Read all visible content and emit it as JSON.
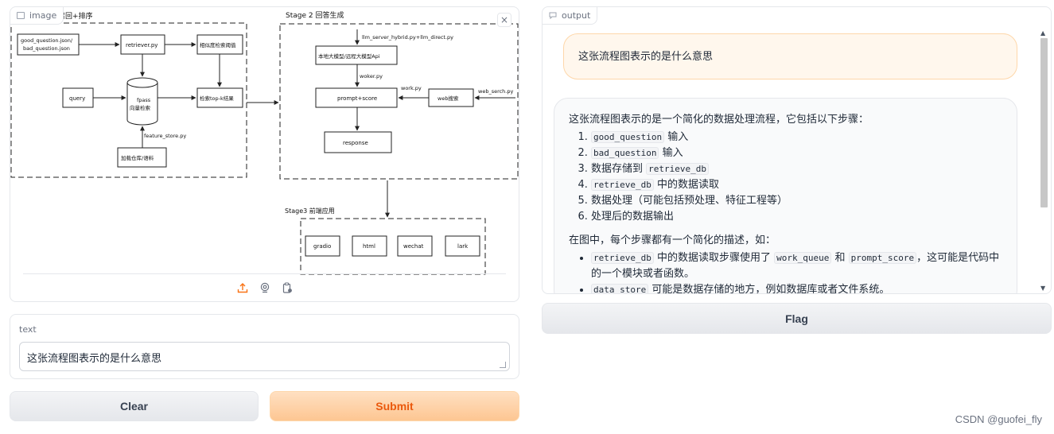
{
  "image_block": {
    "label": "image",
    "label_icon": "image-icon",
    "close_icon": "close-icon",
    "close_symbol": "×",
    "toolbar_icons": [
      "upload-icon",
      "webcam-icon",
      "clipboard-icon"
    ]
  },
  "diagram": {
    "stage1_title": "召回+排序",
    "stage2_title": "Stage 2 回答生成",
    "stage3_title": "Stage3 前端应用",
    "stage1_nodes": {
      "source": [
        "good_question.json/",
        "bad_question.json"
      ],
      "retriever": "retriever.py",
      "threshold": "相似度检索阈值",
      "query": "query",
      "db": [
        "fpass",
        "向量检索"
      ],
      "topk": "检索top-k结果",
      "feature_edge": "feature_store.py",
      "knowledge": "加载仓库/语料"
    },
    "stage2_nodes": {
      "top_edge": "llm_server_hybrid.py+llm_direct.py",
      "model": "本地大模型/远程大模型Api",
      "worker_edge": "woker.py",
      "prompt": "prompt+score",
      "work_edge": "work.py",
      "web": "web搜索",
      "web_edge": "web_serch.py",
      "response": "response"
    },
    "stage3_nodes": [
      "gradio",
      "html",
      "wechat",
      "lark"
    ]
  },
  "text_block": {
    "label": "text",
    "value": "这张流程图表示的是什么意思"
  },
  "buttons": {
    "clear": "Clear",
    "submit": "Submit",
    "flag": "Flag"
  },
  "output_block": {
    "label": "output",
    "label_icon": "chat-icon",
    "user_message": "这张流程图表示的是什么意思",
    "bot_intro": "这张流程图表示的是一个简化的数据处理流程，它包括以下步骤：",
    "steps": [
      {
        "code": "good_question",
        "text": " 输入"
      },
      {
        "code": "bad_question",
        "text": " 输入"
      },
      {
        "pre": "数据存储到 ",
        "code": "retrieve_db",
        "text": ""
      },
      {
        "code": "retrieve_db",
        "text": " 中的数据读取"
      },
      {
        "pre": "数据处理（可能包括预处理、特征工程等）",
        "code": "",
        "text": ""
      },
      {
        "pre": "处理后的数据输出",
        "code": "",
        "text": ""
      }
    ],
    "para2": "在图中，每个步骤都有一个简化的描述，如：",
    "bullet1": {
      "code1": "retrieve_db",
      "t1": " 中的数据读取步骤使用了 ",
      "code2": "work_queue",
      "t2": " 和 ",
      "code3": "prompt_score",
      "t3": "，这可能是代码中的一个模块或者函数。"
    },
    "bullet2": {
      "code1": "data_store",
      "t1": " 可能是数据存储的地方，例如数据库或者文件系统。"
    }
  },
  "watermark": "CSDN @guofei_fly"
}
